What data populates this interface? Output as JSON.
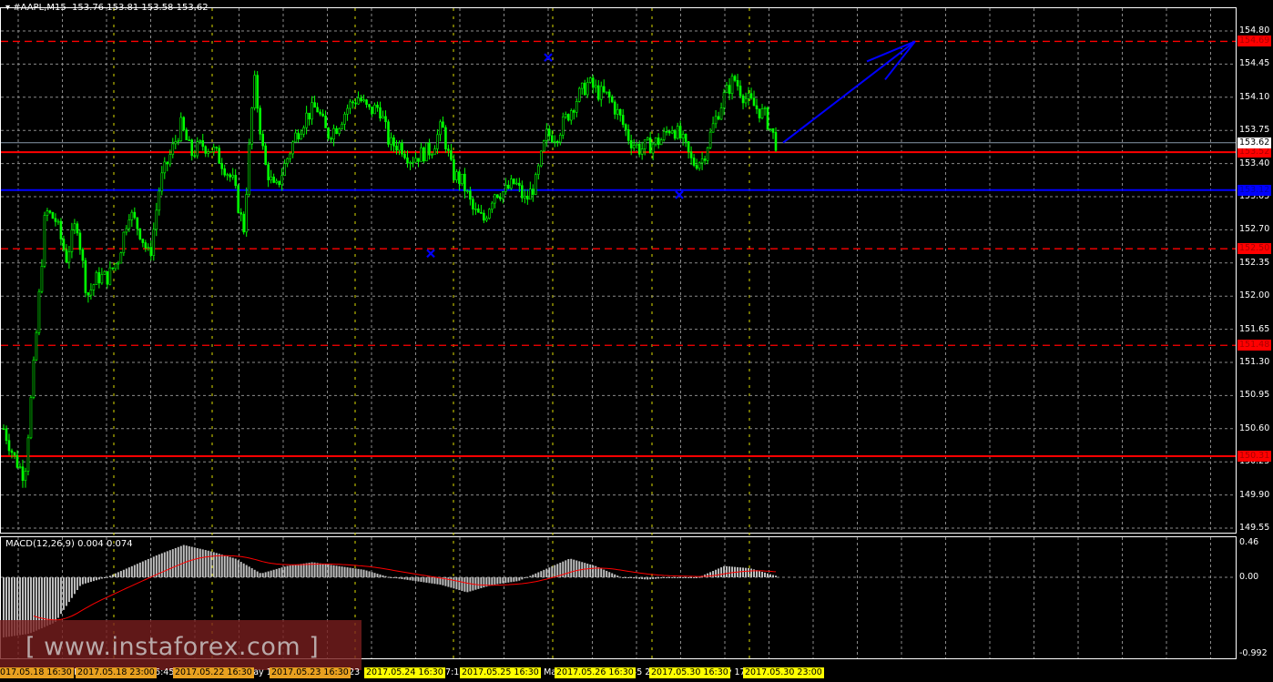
{
  "header": {
    "symbol": "#AAPL,M15",
    "open": "153.76",
    "high": "153.81",
    "low": "153.58",
    "close": "153.62"
  },
  "macd": {
    "label": "MACD(12,26,9)",
    "main": "0.004",
    "signal": "0.074",
    "axis": [
      "0.46",
      "0.00",
      "-0.992"
    ]
  },
  "price_axis": [
    "154.80",
    "154.45",
    "154.10",
    "153.75",
    "153.40",
    "153.05",
    "152.70",
    "152.35",
    "152.00",
    "151.65",
    "151.30",
    "150.95",
    "150.60",
    "150.25",
    "149.90",
    "149.55"
  ],
  "levels": [
    {
      "price": "154.69",
      "style": "dashed",
      "color": "#ff0000"
    },
    {
      "price": "153.52",
      "style": "solid",
      "color": "#ff0000"
    },
    {
      "price": "153.12",
      "style": "solid",
      "color": "#0000ff"
    },
    {
      "price": "152.50",
      "style": "dashed",
      "color": "#ff0000"
    },
    {
      "price": "151.48",
      "style": "dashed",
      "color": "#ff0000"
    },
    {
      "price": "150.31",
      "style": "solid",
      "color": "#ff0000"
    }
  ],
  "current_price": "153.62",
  "time_labels": [
    {
      "text": "2017.05.18 16:30",
      "color": "orange"
    },
    {
      "text": "2017.05.18 23:00",
      "color": "orange"
    },
    {
      "text": "2017.05.22 16:30",
      "color": "orange"
    },
    {
      "text": "2017.05.23 16:30",
      "color": "orange"
    },
    {
      "text": "2017.05.24 16:30",
      "color": "yellow"
    },
    {
      "text": "2017.05.25 16:30",
      "color": "yellow"
    },
    {
      "text": "2017.05.26 16:30",
      "color": "yellow"
    },
    {
      "text": "2017.05.30 16:30",
      "color": "yellow"
    },
    {
      "text": "2017.05.30 23:00",
      "color": "yellow"
    }
  ],
  "time_fragments": [
    "18 M",
    "16:45",
    "May 1",
    "5  23",
    "17:1",
    "5 May",
    ":45  2",
    "ay 17"
  ],
  "watermark": "[ www.instaforex.com ]",
  "colors": {
    "bull": "#00ff00",
    "grid": "#8a8a8a",
    "marker": "#0000ff"
  },
  "chart_data": {
    "type": "candlestick",
    "title": "#AAPL,M15",
    "ylim": [
      149.55,
      154.8
    ],
    "closes": [
      150.6,
      150.3,
      150.1,
      151.4,
      152.9,
      152.8,
      152.4,
      152.8,
      152.0,
      152.2,
      152.2,
      152.4,
      152.9,
      152.7,
      152.4,
      153.2,
      153.5,
      153.8,
      153.5,
      153.6,
      153.55,
      153.4,
      153.2,
      152.7,
      154.3,
      153.4,
      153.1,
      153.4,
      153.7,
      153.9,
      154.0,
      153.7,
      153.8,
      154.0,
      154.1,
      153.95,
      154.0,
      153.6,
      153.6,
      153.45,
      153.5,
      153.55,
      153.8,
      153.3,
      153.2,
      152.9,
      152.8,
      153.1,
      153.1,
      153.2,
      153.0,
      153.2,
      153.7,
      153.7,
      153.9,
      154.1,
      154.25,
      154.15,
      154.1,
      153.9,
      153.65,
      153.55,
      153.6,
      153.65,
      153.8,
      153.65,
      153.4,
      153.45,
      153.8,
      154.1,
      154.3,
      154.1,
      154.0,
      153.9,
      153.62
    ],
    "macd_hist": [
      -0.8,
      -0.75,
      -0.6,
      -0.1,
      0.0,
      0.15,
      0.3,
      0.43,
      0.35,
      0.25,
      0.05,
      0.15,
      0.2,
      0.15,
      0.1,
      0.0,
      -0.05,
      -0.1,
      -0.2,
      -0.1,
      -0.05,
      0.1,
      0.25,
      0.15,
      0.0,
      -0.03,
      0.0,
      0.0,
      0.15,
      0.12,
      0.02
    ],
    "markers": [
      {
        "type": "x",
        "price": 154.52
      },
      {
        "type": "x",
        "price": 152.45
      },
      {
        "type": "x",
        "price": 153.07
      }
    ],
    "arrow": {
      "from_price": 153.62,
      "to_price": 154.69
    }
  }
}
